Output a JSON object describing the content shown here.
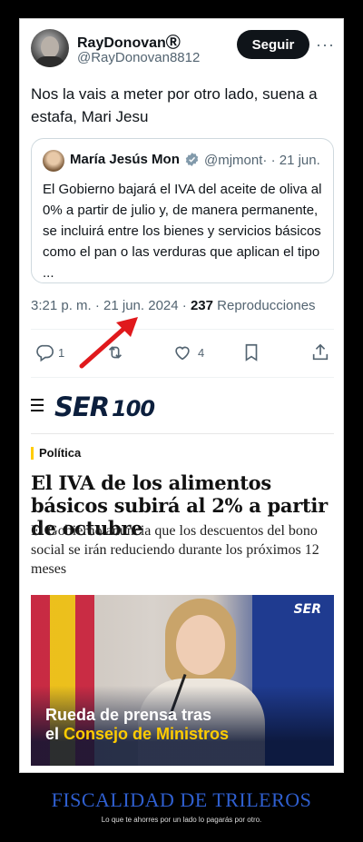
{
  "tweet": {
    "author_name": "RayDonovanⓇ",
    "author_handle": "@RayDonovan8812",
    "follow_label": "Seguir",
    "more_label": "···",
    "text": "Nos la vais a meter por otro lado, suena a estafa, Mari Jesu",
    "quoted": {
      "name": "María Jesús Mon",
      "handle": "@mjmont· · 21 jun.",
      "text": "El Gobierno bajará el IVA del aceite de oliva al 0% a partir de julio y, de manera permanente, se incluirá entre los bienes y servicios básicos como el pan o las verduras que aplican el tipo ..."
    },
    "timestamp": "3:21 p. m. · 21 jun. 2024 ·",
    "views_count": "237",
    "views_label": "Reproducciones",
    "actions": {
      "reply_count": "1",
      "retweet_count": "",
      "like_count": "4"
    }
  },
  "news": {
    "brand": "SER",
    "brand_number": "100",
    "section": "Política",
    "headline": "El IVA de los alimentos básicos subirá al 2% a partir de octubre",
    "subhead": "El Gobierno anuncia que los descuentos del bono social se irán reduciendo durante los próximos 12 meses",
    "image": {
      "logo": "SER",
      "caption_line1": "Rueda de prensa tras",
      "caption_line2_prefix": "el",
      "caption_line2_highlight": "Consejo de Ministros"
    }
  },
  "meme": {
    "title": "FISCALIDAD DE TRILEROS",
    "subtitle": "Lo que te ahorres por un lado lo pagarás por otro."
  },
  "colors": {
    "accent_red": "#e0191c",
    "ser_yellow": "#ffcc00",
    "meme_title": "#2f5fd0"
  }
}
